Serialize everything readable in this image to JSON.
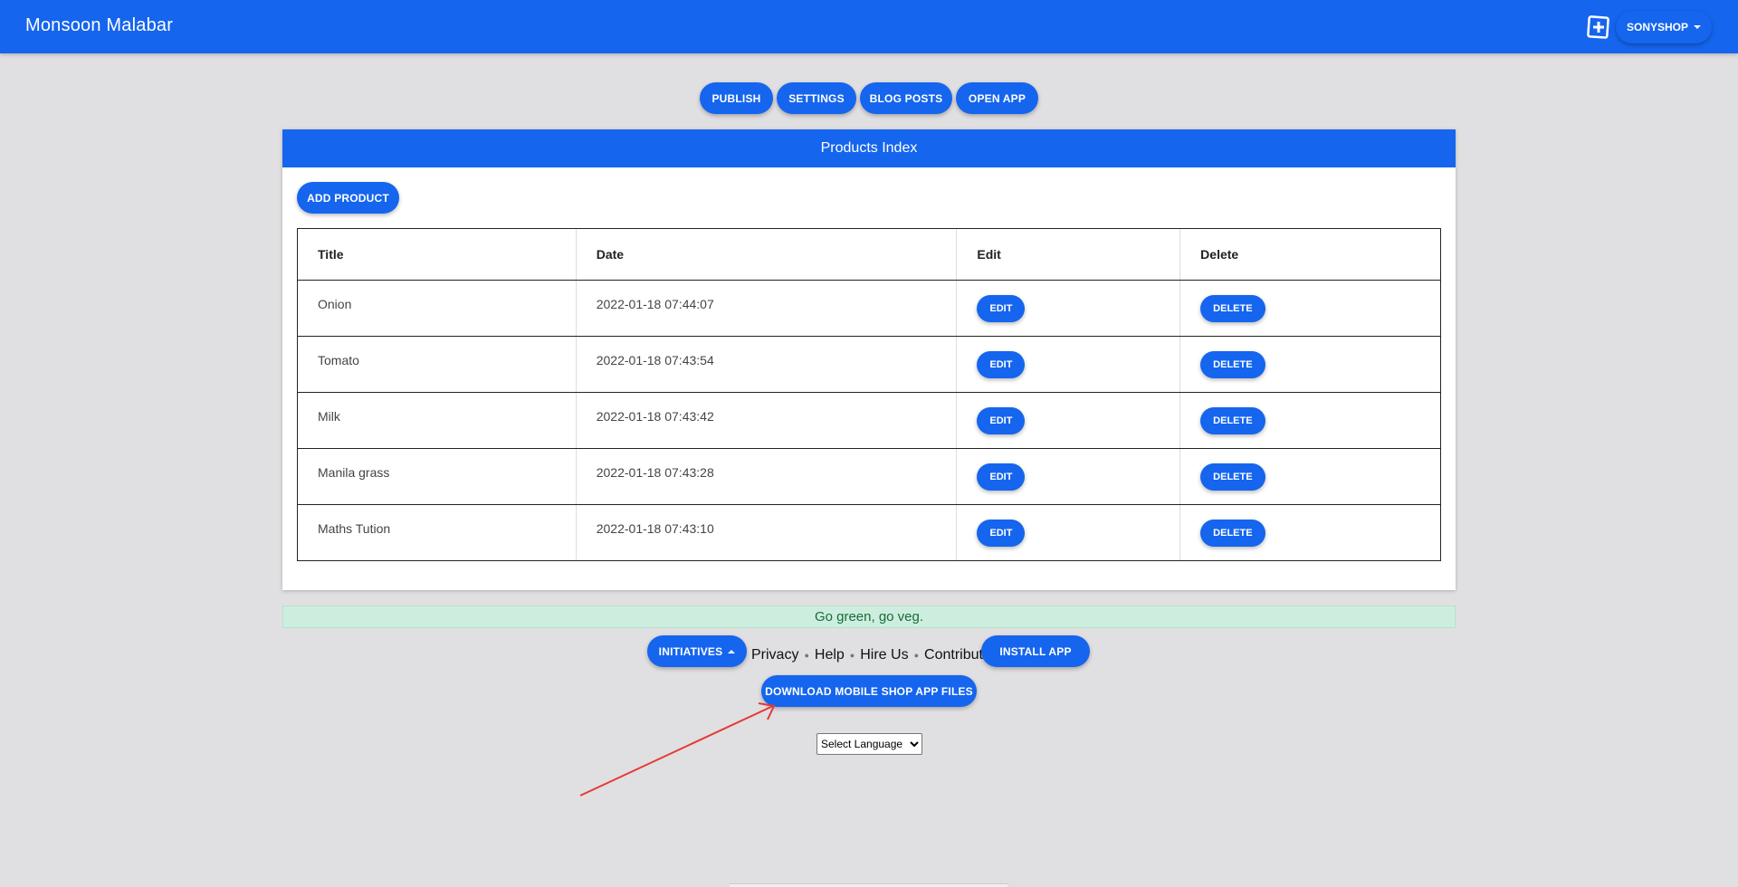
{
  "app": {
    "title": "Monsoon Malabar"
  },
  "header": {
    "add_icon": "plus-square-icon",
    "user_menu_label": "SONYSHOP"
  },
  "toolbar": {
    "publish": "PUBLISH",
    "settings": "SETTINGS",
    "blog_posts": "BLOG POSTS",
    "open_app": "OPEN APP"
  },
  "products": {
    "title": "Products Index",
    "add_label": "ADD PRODUCT",
    "columns": [
      "Title",
      "Date",
      "Edit",
      "Delete"
    ],
    "edit_label": "EDIT",
    "delete_label": "DELETE",
    "rows": [
      {
        "title": "Onion",
        "date": "2022-01-18 07:44:07"
      },
      {
        "title": "Tomato",
        "date": "2022-01-18 07:43:54"
      },
      {
        "title": "Milk",
        "date": "2022-01-18 07:43:42"
      },
      {
        "title": "Manila grass",
        "date": "2022-01-18 07:43:28"
      },
      {
        "title": "Maths Tution",
        "date": "2022-01-18 07:43:10"
      }
    ]
  },
  "alert": {
    "text": "Go green, go veg."
  },
  "footer": {
    "initiatives": "INITIATIVES",
    "links": [
      "Privacy",
      "Help",
      "Hire Us",
      "Contribute"
    ],
    "install_app": "INSTALL APP",
    "download": "DOWNLOAD MOBILE SHOP APP FILES",
    "language_placeholder": "Select Language"
  },
  "colors": {
    "primary": "#1565ee",
    "background": "#e0dfe1",
    "alert_bg": "#cdeede",
    "alert_text": "#176b3a",
    "annotation_arrow": "#e53935"
  }
}
